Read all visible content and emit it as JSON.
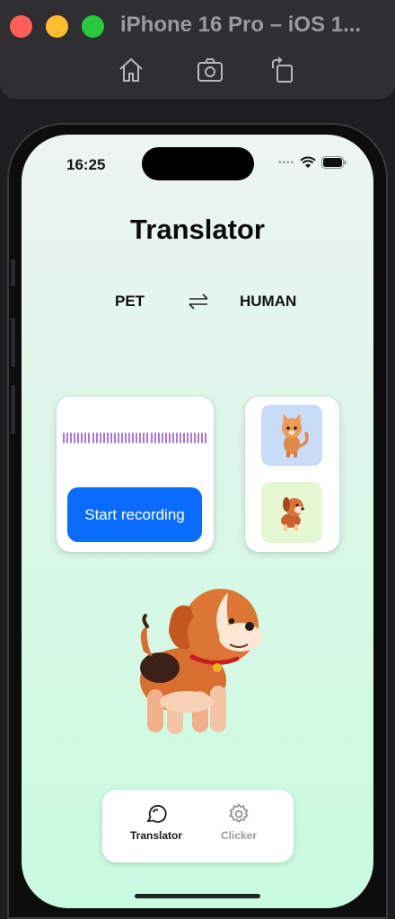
{
  "simulator": {
    "title": "iPhone 16 Pro – iOS 1...",
    "toolbar": [
      "home-icon",
      "screenshot-icon",
      "rotate-icon"
    ]
  },
  "status_bar": {
    "time": "16:25"
  },
  "app": {
    "title": "Translator",
    "source_language": "PET",
    "target_language": "HUMAN",
    "record_button": "Start recording",
    "waveform_color": "#a877e0",
    "accent_color": "#0a6cff"
  },
  "pets": [
    {
      "name": "cat",
      "icon": "cat-icon",
      "tile_color": "#c8dcf8"
    },
    {
      "name": "dog",
      "icon": "dog-icon",
      "tile_color": "#e6f7d4"
    }
  ],
  "tabbar": {
    "items": [
      {
        "label": "Translator",
        "icon": "chat-bubble-icon",
        "active": true
      },
      {
        "label": "Clicker",
        "icon": "gear-icon",
        "active": false
      }
    ]
  }
}
